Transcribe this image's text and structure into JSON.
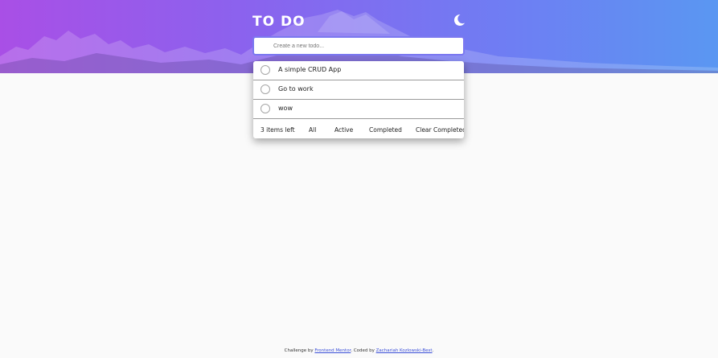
{
  "header": {
    "title": "TO DO",
    "theme_toggle_icon": "moon-icon"
  },
  "new_todo": {
    "placeholder": "Create a new todo..."
  },
  "todos": [
    {
      "text": "A simple CRUD App",
      "completed": false
    },
    {
      "text": "Go to work",
      "completed": false
    },
    {
      "text": "wow",
      "completed": false
    }
  ],
  "footer": {
    "items_left": "3 items left",
    "filter_all": "All",
    "filter_active": "Active",
    "filter_completed": "Completed",
    "clear_completed": "Clear Completed"
  },
  "attribution": {
    "prefix": "Challenge by",
    "frontend_mentor": "Frontend Mentor",
    "middle": ". Coded by",
    "author": "Zachariah Kozlowski-Best",
    "suffix": "."
  },
  "colors": {
    "gradient_start": "#a94fe6",
    "gradient_end": "#5a97f2",
    "input_border": "#7b78f0",
    "background": "#fafafa"
  }
}
